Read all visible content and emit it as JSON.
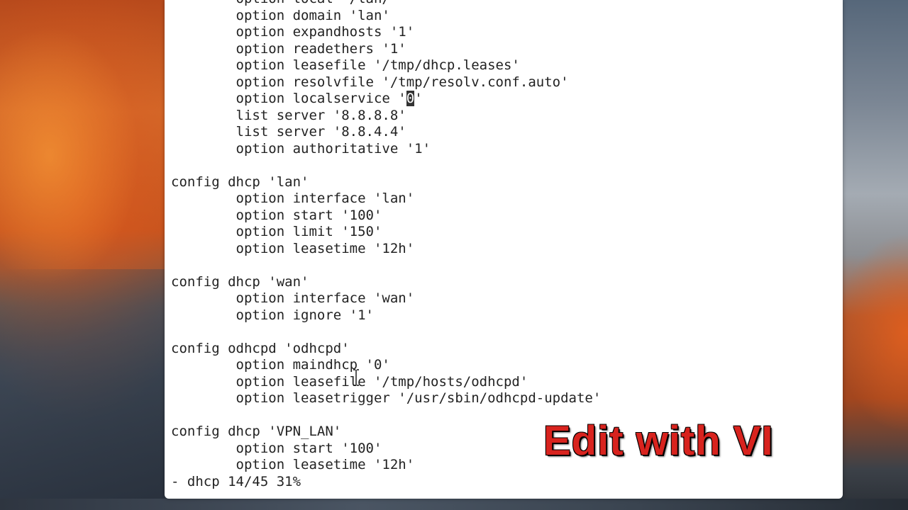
{
  "terminal": {
    "lines": [
      "        option local '/lan/'",
      "        option domain 'lan'",
      "        option expandhosts '1'",
      "        option readethers '1'",
      "        option leasefile '/tmp/dhcp.leases'",
      "        option resolvfile '/tmp/resolv.conf.auto'",
      "        option localservice '",
      "        list server '8.8.8.8'",
      "        list server '8.8.4.4'",
      "        option authoritative '1'",
      "",
      "config dhcp 'lan'",
      "        option interface 'lan'",
      "        option start '100'",
      "        option limit '150'",
      "        option leasetime '12h'",
      "",
      "config dhcp 'wan'",
      "        option interface 'wan'",
      "        option ignore '1'",
      "",
      "config odhcpd 'odhcpd'",
      "        option maindhcp '0'",
      "        option leasefile '/tmp/hosts/odhcpd'",
      "        option leasetrigger '/usr/sbin/odhcpd-update'",
      "",
      "config dhcp 'VPN_LAN'",
      "        option start '100'",
      "        option leasetime '12h'"
    ],
    "cursor_line_prefix": "        option localservice '",
    "cursor_char": "0",
    "cursor_line_suffix": "'",
    "status_line": "- dhcp 14/45 31%"
  },
  "overlay": {
    "caption": "Edit with VI",
    "color": "#d8231e"
  }
}
